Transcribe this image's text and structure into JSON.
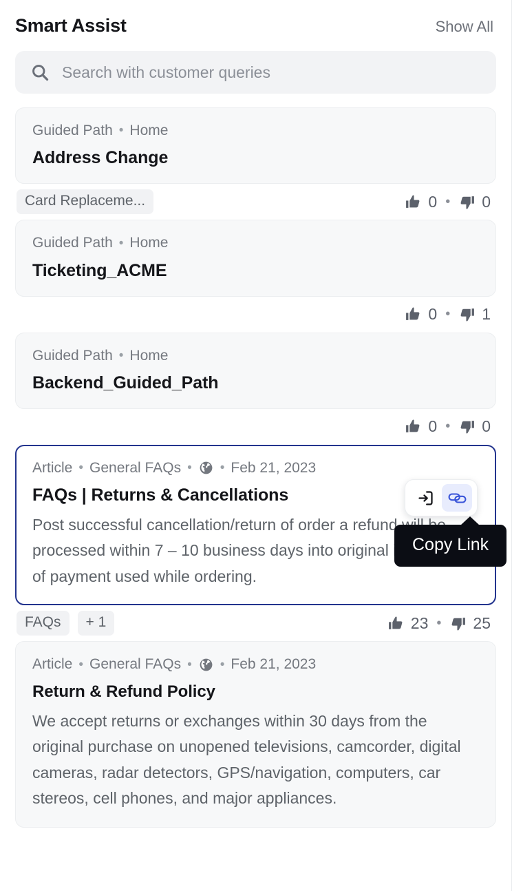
{
  "header": {
    "title": "Smart Assist",
    "show_all_label": "Show All"
  },
  "search": {
    "placeholder": "Search with customer queries",
    "value": "",
    "icon": "search-icon"
  },
  "results": [
    {
      "type": "Guided Path",
      "source": "Home",
      "separator": "•",
      "title": "Address Change",
      "body": "",
      "tags": [
        "Card Replaceme..."
      ],
      "upvotes": "0",
      "downvotes": "0",
      "selected": false,
      "has_globe": false,
      "date": ""
    },
    {
      "type": "Guided Path",
      "source": "Home",
      "separator": "•",
      "title": "Ticketing_ACME",
      "body": "",
      "tags": [],
      "upvotes": "0",
      "downvotes": "1",
      "selected": false,
      "has_globe": false,
      "date": ""
    },
    {
      "type": "Guided Path",
      "source": "Home",
      "separator": "•",
      "title": "Backend_Guided_Path",
      "body": "",
      "tags": [],
      "upvotes": "0",
      "downvotes": "0",
      "selected": false,
      "has_globe": false,
      "date": ""
    },
    {
      "type": "Article",
      "source": "General FAQs",
      "separator": "•",
      "title": "FAQs | Returns & Cancellations",
      "body": "Post successful cancellation/return of order a refund will be processed within 7 – 10 business days into original instrument of payment used while ordering.",
      "tags": [
        "FAQs",
        "+ 1"
      ],
      "upvotes": "23",
      "downvotes": "25",
      "selected": true,
      "has_globe": true,
      "date": "Feb 21, 2023"
    },
    {
      "type": "Article",
      "source": "General FAQs",
      "separator": "•",
      "title": "Return & Refund Policy",
      "body": "We accept returns or exchanges within 30 days from the original purchase on unopened televisions, camcorder, digital cameras, radar detectors, GPS/navigation, computers, car stereos, cell phones, and major appliances.",
      "tags": [],
      "upvotes": "",
      "downvotes": "",
      "selected": false,
      "has_globe": true,
      "date": "Feb 21, 2023"
    }
  ],
  "action_bar": {
    "insert_icon": "insert-into-box-icon",
    "link_icon": "link-icon",
    "active": "link-icon"
  },
  "tooltip": {
    "text": "Copy Link"
  },
  "icons": {
    "thumbs_up": "thumbs-up-icon",
    "thumbs_down": "thumbs-down-icon",
    "globe": "globe-icon"
  },
  "colors": {
    "accent_blue": "#23348e",
    "link_blue": "#3a55d9",
    "card_bg": "#f7f8f9",
    "tooltip_bg": "#0b0d14",
    "text_primary": "#15161a",
    "text_secondary": "#74787f"
  }
}
